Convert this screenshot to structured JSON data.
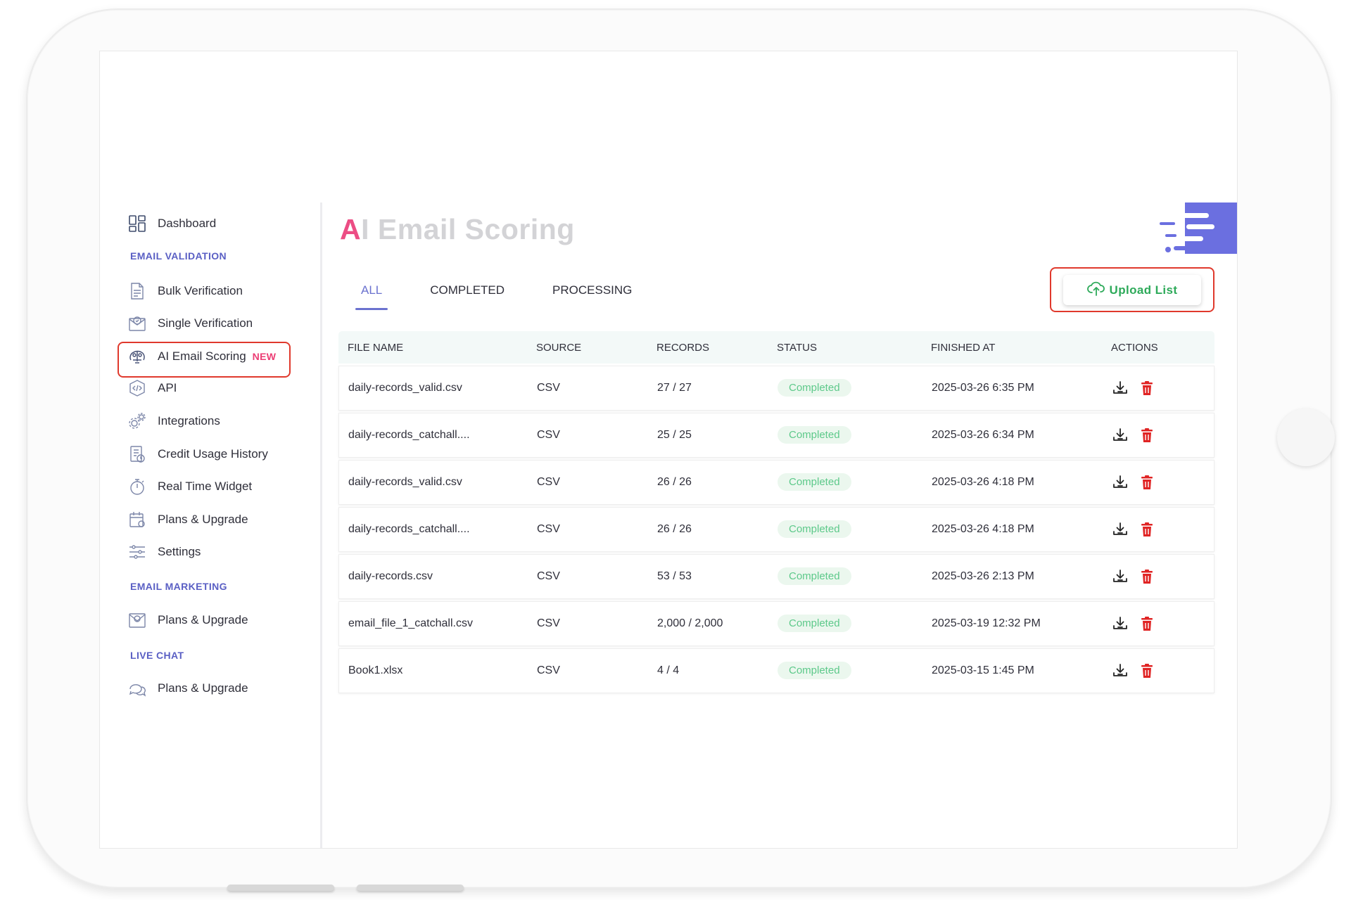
{
  "sidebar": {
    "items": [
      {
        "label": "Dashboard",
        "icon": "dashboard-icon"
      },
      {
        "label": "Bulk Verification",
        "icon": "bulk-file-icon"
      },
      {
        "label": "Single Verification",
        "icon": "envelope-check-icon"
      },
      {
        "label": "AI Email Scoring",
        "icon": "ai-brain-icon",
        "badge": "NEW"
      },
      {
        "label": "API",
        "icon": "api-code-icon"
      },
      {
        "label": "Integrations",
        "icon": "gears-icon"
      },
      {
        "label": "Credit Usage History",
        "icon": "credit-history-icon"
      },
      {
        "label": "Real Time Widget",
        "icon": "stopwatch-icon"
      },
      {
        "label": "Plans & Upgrade",
        "icon": "plans-calendar-icon"
      },
      {
        "label": "Settings",
        "icon": "sliders-icon"
      },
      {
        "label": "Plans & Upgrade",
        "icon": "email-marketing-icon"
      },
      {
        "label": "Plans & Upgrade",
        "icon": "chat-bubbles-icon"
      }
    ],
    "sections": {
      "email_validation": "EMAIL VALIDATION",
      "email_marketing": "EMAIL MARKETING",
      "live_chat": "LIVE CHAT"
    }
  },
  "page": {
    "title_first": "A",
    "title_rest": "I Email Scoring"
  },
  "tabs": [
    "ALL",
    "COMPLETED",
    "PROCESSING"
  ],
  "active_tab": "ALL",
  "upload_button": {
    "label": "Upload List",
    "icon": "cloud-upload-icon"
  },
  "table": {
    "headers": [
      "FILE NAME",
      "SOURCE",
      "RECORDS",
      "STATUS",
      "FINISHED AT",
      "ACTIONS"
    ],
    "rows": [
      {
        "file": "daily-records_valid.csv",
        "source": "CSV",
        "records": "27 / 27",
        "status": "Completed",
        "finished": "2025-03-26 6:35 PM"
      },
      {
        "file": "daily-records_catchall....",
        "source": "CSV",
        "records": "25 / 25",
        "status": "Completed",
        "finished": "2025-03-26 6:34 PM"
      },
      {
        "file": "daily-records_valid.csv",
        "source": "CSV",
        "records": "26 / 26",
        "status": "Completed",
        "finished": "2025-03-26 4:18 PM"
      },
      {
        "file": "daily-records_catchall....",
        "source": "CSV",
        "records": "26 / 26",
        "status": "Completed",
        "finished": "2025-03-26 4:18 PM"
      },
      {
        "file": "daily-records.csv",
        "source": "CSV",
        "records": "53 / 53",
        "status": "Completed",
        "finished": "2025-03-26 2:13 PM"
      },
      {
        "file": "email_file_1_catchall.csv",
        "source": "CSV",
        "records": "2,000 / 2,000",
        "status": "Completed",
        "finished": "2025-03-19 12:32 PM"
      },
      {
        "file": "Book1.xlsx",
        "source": "CSV",
        "records": "4 / 4",
        "status": "Completed",
        "finished": "2025-03-15 1:45 PM"
      }
    ],
    "action_icons": [
      "download-icon",
      "trash-icon"
    ]
  },
  "colors": {
    "accent": "#6b72cf",
    "section_heading": "#5a5fc4",
    "badge": "#ec3d74",
    "title_first": "#ec4d84",
    "title_rest": "#d3d3d6",
    "status_text": "#5dc98a",
    "status_bg": "#ebf7ee",
    "upload_text": "#2eaa5a",
    "highlight_outline": "#e0392c",
    "delete": "#e02424",
    "logo": "#6b6fe0"
  }
}
